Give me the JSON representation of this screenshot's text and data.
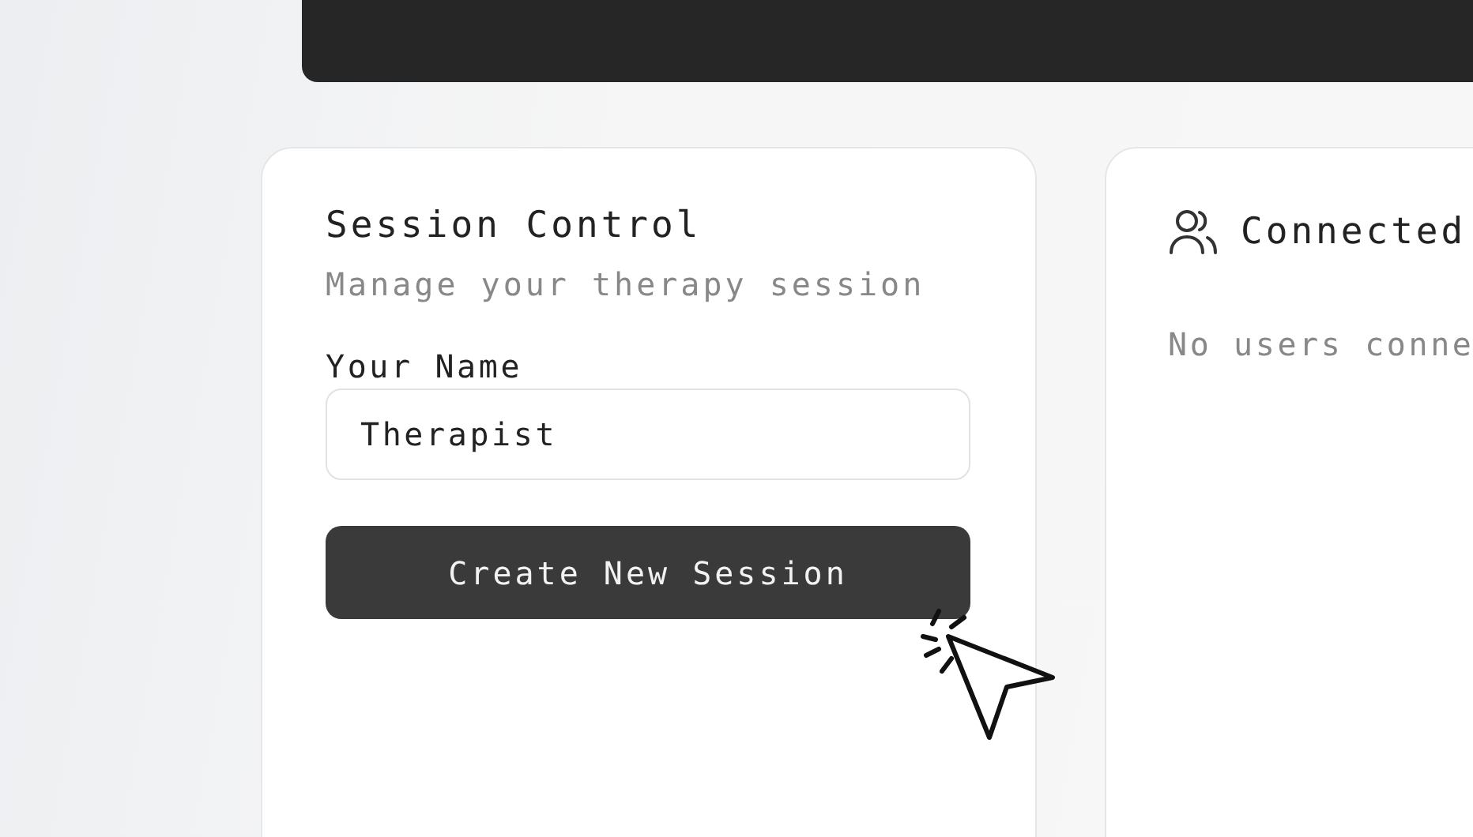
{
  "session_card": {
    "title": "Session Control",
    "subtitle": "Manage your therapy session",
    "name_field": {
      "label": "Your Name",
      "value": "Therapist"
    },
    "button": "Create New Session"
  },
  "users_card": {
    "title": "Connected",
    "empty_text": "No users conne"
  }
}
